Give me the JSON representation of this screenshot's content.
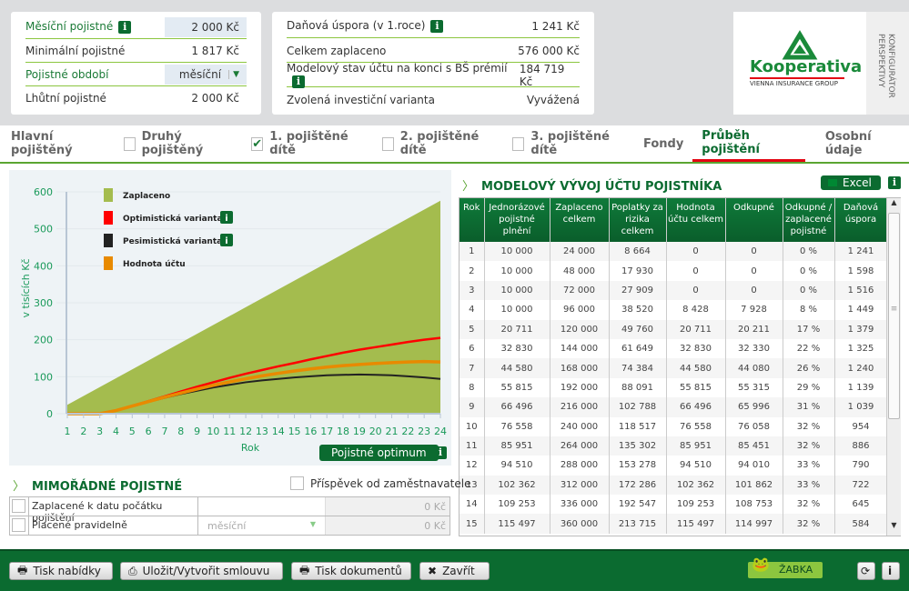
{
  "summary_left": {
    "rows": [
      {
        "label": "Měsíční pojistné",
        "value": "2 000 Kč",
        "info": true
      },
      {
        "label": "Minimální pojistné",
        "value": "1 817 Kč"
      },
      {
        "label": "Pojistné období",
        "value": "měsíční"
      },
      {
        "label": "Lhůtní pojistné",
        "value": "2 000 Kč"
      }
    ]
  },
  "summary_right": {
    "rows": [
      {
        "label": "Daňová úspora (v 1.roce)",
        "value": "1 241 Kč"
      },
      {
        "label": "Celkem zaplaceno",
        "value": "576 000 Kč"
      },
      {
        "label": "Modelový stav účtu na konci s BŠ prémií",
        "value": "184 719 Kč"
      },
      {
        "label": "Zvolená investiční varianta",
        "value": "Vyvážená"
      }
    ]
  },
  "logo": {
    "name": "Kooperativa",
    "tagline": "VIENNA INSURANCE GROUP"
  },
  "side_label": "KONFIGURÁTOR PERSPEKTIVY",
  "tabs": [
    {
      "label": "Hlavní pojištěný"
    },
    {
      "label": "Druhý pojištěný",
      "checkbox": false
    },
    {
      "label": "1. pojištěné dítě",
      "checkbox": true
    },
    {
      "label": "2. pojištěné dítě",
      "checkbox": false
    },
    {
      "label": "3. pojištěné dítě",
      "checkbox": false
    },
    {
      "label": "Fondy"
    },
    {
      "label": "Průběh pojištění",
      "active": true
    },
    {
      "label": "Osobní údaje"
    }
  ],
  "colors": {
    "brand": "#0b6b30",
    "paid": "#a4bc4e",
    "optimistic": "#ff0000",
    "pessimistic": "#222222",
    "account": "#e88a00",
    "active_tab": "#e30613"
  },
  "chart_data": {
    "type": "area+line",
    "xlabel": "Rok",
    "ylabel": "v tisících Kč",
    "ylim": [
      0,
      600
    ],
    "yticks": [
      0,
      100,
      200,
      300,
      400,
      500,
      600
    ],
    "x": [
      1,
      2,
      3,
      4,
      5,
      6,
      7,
      8,
      9,
      10,
      11,
      12,
      13,
      14,
      15,
      16,
      17,
      18,
      19,
      20,
      21,
      22,
      23,
      24
    ],
    "legend_position": "top-left",
    "series": [
      {
        "name": "Zaplaceno",
        "kind": "area",
        "values": [
          24,
          48,
          72,
          96,
          120,
          144,
          168,
          192,
          216,
          240,
          264,
          288,
          312,
          336,
          360,
          384,
          408,
          432,
          456,
          480,
          504,
          528,
          552,
          576
        ]
      },
      {
        "name": "Optimistická varianta",
        "kind": "line",
        "values": [
          0,
          0,
          0,
          9,
          21,
          34,
          47,
          60,
          73,
          85,
          97,
          108,
          118,
          128,
          137,
          147,
          156,
          165,
          173,
          180,
          187,
          194,
          200,
          205
        ]
      },
      {
        "name": "Pesimistická varianta",
        "kind": "line",
        "values": [
          0,
          0,
          0,
          8,
          20,
          32,
          43,
          53,
          62,
          71,
          78,
          85,
          90,
          94,
          98,
          101,
          104,
          105,
          106,
          105,
          104,
          101,
          98,
          94
        ]
      },
      {
        "name": "Hodnota účtu",
        "kind": "line",
        "values": [
          0,
          0,
          0,
          8.4,
          20.7,
          32.8,
          44.6,
          55.8,
          66.5,
          76.6,
          86,
          94.5,
          102.4,
          109.3,
          115.5,
          121,
          126,
          130,
          133,
          136,
          138,
          140,
          141,
          140
        ]
      }
    ]
  },
  "optimum_button": "Pojistné optimum",
  "table": {
    "title": "MODELOVÝ VÝVOJ ÚČTU POJISTNÍKA",
    "excel": "Excel",
    "headers": [
      "Rok",
      "Jednorázové pojistné plnění",
      "Zaplaceno celkem",
      "Poplatky za rizika celkem",
      "Hodnota účtu celkem",
      "Odkupné",
      "Odkupné / zaplacené pojistné",
      "Daňová úspora"
    ],
    "rows": [
      [
        "1",
        "10 000",
        "24 000",
        "8 664",
        "0",
        "0",
        "0 %",
        "1 241"
      ],
      [
        "2",
        "10 000",
        "48 000",
        "17 930",
        "0",
        "0",
        "0 %",
        "1 598"
      ],
      [
        "3",
        "10 000",
        "72 000",
        "27 909",
        "0",
        "0",
        "0 %",
        "1 516"
      ],
      [
        "4",
        "10 000",
        "96 000",
        "38 520",
        "8 428",
        "7 928",
        "8 %",
        "1 449"
      ],
      [
        "5",
        "20 711",
        "120 000",
        "49 760",
        "20 711",
        "20 211",
        "17 %",
        "1 379"
      ],
      [
        "6",
        "32 830",
        "144 000",
        "61 649",
        "32 830",
        "32 330",
        "22 %",
        "1 325"
      ],
      [
        "7",
        "44 580",
        "168 000",
        "74 384",
        "44 580",
        "44 080",
        "26 %",
        "1 240"
      ],
      [
        "8",
        "55 815",
        "192 000",
        "88 091",
        "55 815",
        "55 315",
        "29 %",
        "1 139"
      ],
      [
        "9",
        "66 496",
        "216 000",
        "102 788",
        "66 496",
        "65 996",
        "31 %",
        "1 039"
      ],
      [
        "10",
        "76 558",
        "240 000",
        "118 517",
        "76 558",
        "76 058",
        "32 %",
        "954"
      ],
      [
        "11",
        "85 951",
        "264 000",
        "135 302",
        "85 951",
        "85 451",
        "32 %",
        "886"
      ],
      [
        "12",
        "94 510",
        "288 000",
        "153 278",
        "94 510",
        "94 010",
        "33 %",
        "790"
      ],
      [
        "13",
        "102 362",
        "312 000",
        "172 286",
        "102 362",
        "101 862",
        "33 %",
        "722"
      ],
      [
        "14",
        "109 253",
        "336 000",
        "192 547",
        "109 253",
        "108 753",
        "32 %",
        "645"
      ],
      [
        "15",
        "115 497",
        "360 000",
        "213 715",
        "115 497",
        "114 997",
        "32 %",
        "584"
      ]
    ]
  },
  "extra": {
    "title": "MIMOŘÁDNÉ POJISTNÉ",
    "employer": "Příspěvek od zaměstnavatele",
    "rows": [
      {
        "label": "Zaplacené k datu počátku pojištění",
        "period": "",
        "value": "0 Kč"
      },
      {
        "label": "Placené pravidelně",
        "period": "měsíční",
        "value": "0 Kč"
      }
    ]
  },
  "footer": {
    "print_offer": "Tisk nabídky",
    "save": "Uložit/Vytvořit smlouvu",
    "print_docs": "Tisk dokumentů",
    "close": "Zavřít",
    "zabka": "ŽABKA"
  }
}
